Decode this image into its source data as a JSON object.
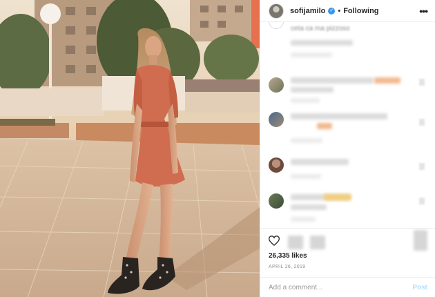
{
  "post": {
    "username": "sofijamilo",
    "verified_icon": "verified-badge-icon",
    "separator": "•",
    "follow_status": "Following",
    "more_icon": "more-options-icon",
    "caption_snippet": "ceta ca ma pizzoso",
    "likes": "26,335 likes",
    "date": "APRIL 26, 2019",
    "comment_placeholder": "Add a comment...",
    "post_label": "Post"
  },
  "colors": {
    "verified": "#3897f0",
    "post_disabled": "#b2dffc",
    "text": "#262626",
    "secondary": "#8e8e8e"
  }
}
